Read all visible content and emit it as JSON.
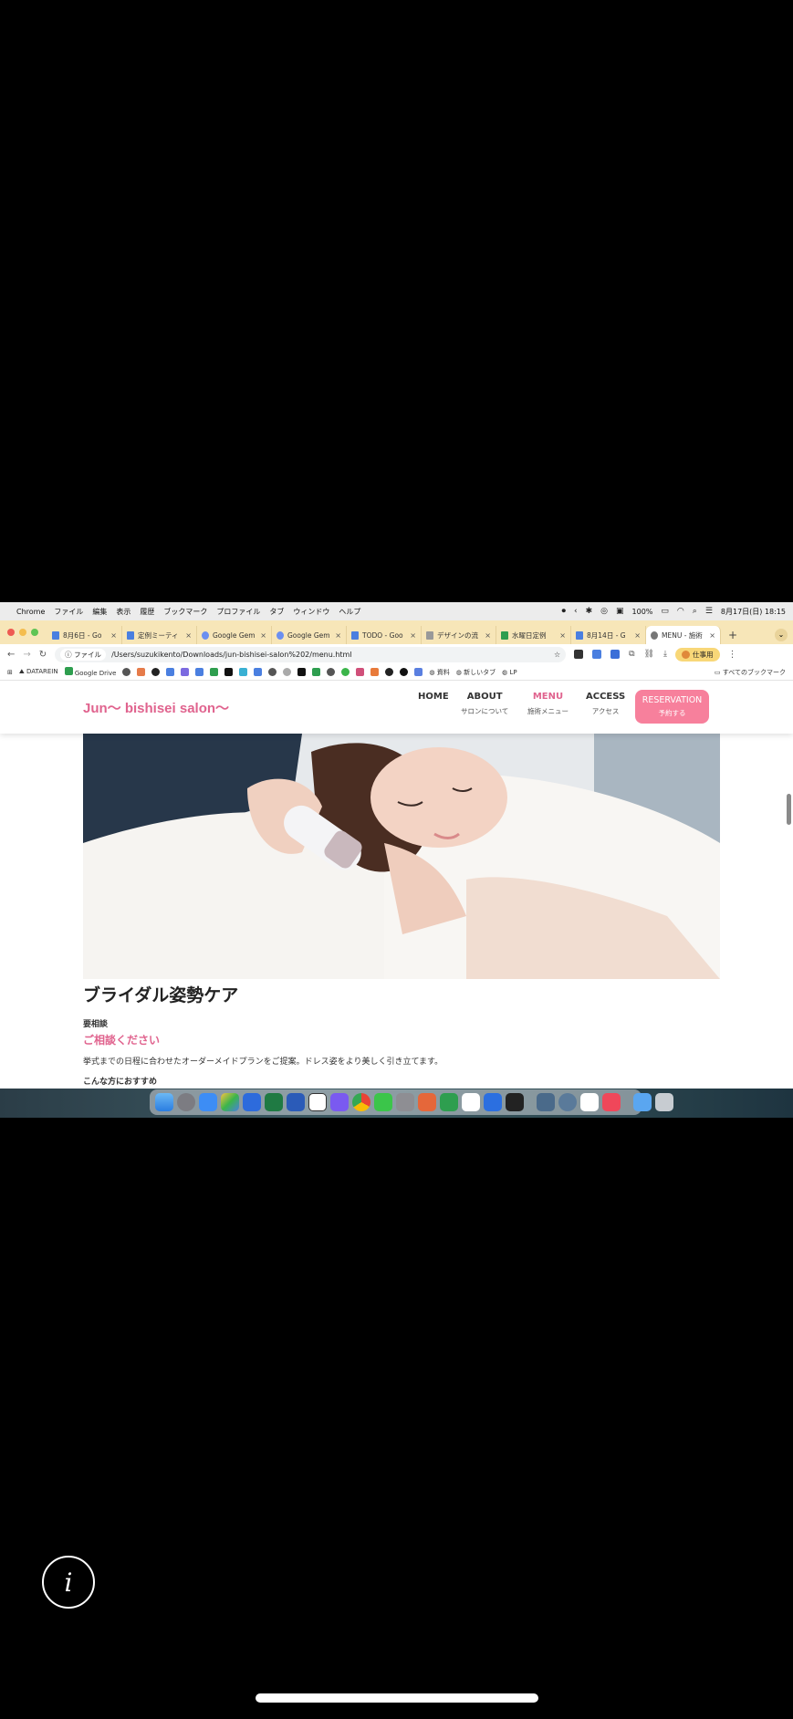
{
  "menubar": {
    "app_name": "Chrome",
    "menus": [
      "ファイル",
      "編集",
      "表示",
      "履歴",
      "ブックマーク",
      "プロファイル",
      "タブ",
      "ウィンドウ",
      "ヘルプ"
    ],
    "battery": "100%",
    "datetime": "8月17日(日) 18:15"
  },
  "tabs": [
    {
      "title": "8月6日 - Go",
      "color": "#4a7fe0"
    },
    {
      "title": "定例ミーティ",
      "color": "#4a7fe0"
    },
    {
      "title": "Google Gem",
      "color": "#6b8ff0"
    },
    {
      "title": "Google Gem",
      "color": "#6b8ff0"
    },
    {
      "title": "TODO - Goo",
      "color": "#4a7fe0"
    },
    {
      "title": "デザインの流",
      "color": "#999999"
    },
    {
      "title": "水曜日定例",
      "color": "#2e9e4f"
    },
    {
      "title": "8月14日 - G",
      "color": "#4a7fe0"
    },
    {
      "title": "MENU - 施術",
      "color": "#777777"
    }
  ],
  "toolbar": {
    "file_chip": "ファイル",
    "url": "/Users/suzukikento/Downloads/jun-bishisei-salon%202/menu.html",
    "profile_label": "仕事用"
  },
  "bookmarks": {
    "items": [
      "DATAREIN",
      "Google Drive",
      "資料",
      "新しいタブ",
      "LP"
    ],
    "all_label": "すべてのブックマーク"
  },
  "site": {
    "logo": "Jun〜 bishisei salon〜",
    "nav": [
      {
        "en": "HOME",
        "jp": ""
      },
      {
        "en": "ABOUT",
        "jp": "サロンについて"
      },
      {
        "en": "MENU",
        "jp": "施術メニュー"
      },
      {
        "en": "ACCESS",
        "jp": "アクセス"
      }
    ],
    "reservation": {
      "en": "RESERVATION",
      "jp": "予約する"
    },
    "accent_color": "#e0638e"
  },
  "menu_item": {
    "title": "ブライダル姿勢ケア",
    "note": "要相談",
    "cta": "ご相談ください",
    "description": "挙式までの日程に合わせたオーダーメイドプランをご提案。ドレス姿をより美しく引き立てます。",
    "subheading": "こんな方におすすめ"
  }
}
